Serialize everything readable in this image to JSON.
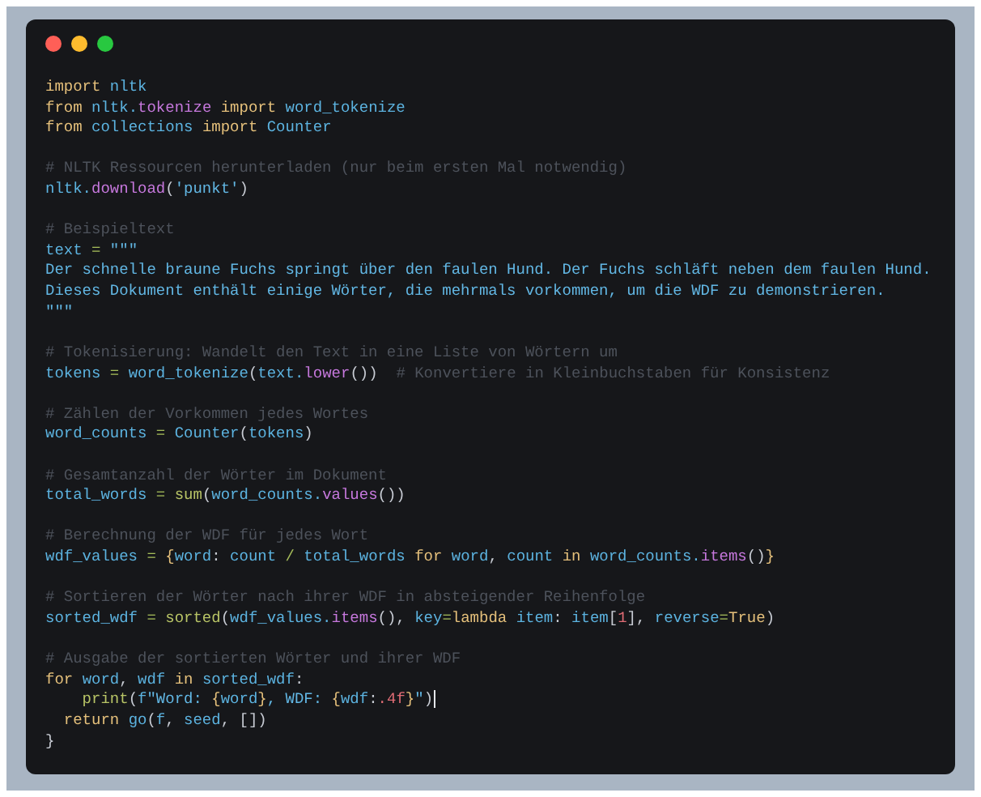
{
  "window": {
    "controls": [
      {
        "kind": "close"
      },
      {
        "kind": "minimize"
      },
      {
        "kind": "maximize"
      }
    ]
  },
  "lines": [
    {
      "kind": "code",
      "tokens": [
        {
          "kind": "kw",
          "text": "import "
        },
        {
          "kind": "name",
          "text": "nltk"
        }
      ]
    },
    {
      "kind": "code",
      "tokens": [
        {
          "kind": "kw",
          "text": "from "
        },
        {
          "kind": "name",
          "text": "nltk."
        },
        {
          "kind": "attr",
          "text": "tokenize "
        },
        {
          "kind": "kw",
          "text": "import "
        },
        {
          "kind": "name",
          "text": "word_tokenize"
        }
      ]
    },
    {
      "kind": "code",
      "tokens": [
        {
          "kind": "kw",
          "text": "from "
        },
        {
          "kind": "name",
          "text": "collections "
        },
        {
          "kind": "kw",
          "text": "import "
        },
        {
          "kind": "name",
          "text": "Counter"
        }
      ]
    },
    {
      "kind": "blank"
    },
    {
      "kind": "code",
      "tokens": [
        {
          "kind": "comment",
          "text": "# NLTK Ressourcen herunterladen (nur beim ersten Mal notwendig)"
        }
      ]
    },
    {
      "kind": "code",
      "tokens": [
        {
          "kind": "name",
          "text": "nltk."
        },
        {
          "kind": "attr",
          "text": "download"
        },
        {
          "kind": "punct",
          "text": "("
        },
        {
          "kind": "str",
          "text": "'punkt'"
        },
        {
          "kind": "punct",
          "text": ")"
        }
      ]
    },
    {
      "kind": "blank"
    },
    {
      "kind": "code",
      "tokens": [
        {
          "kind": "comment",
          "text": "# Beispieltext"
        }
      ]
    },
    {
      "kind": "code",
      "tokens": [
        {
          "kind": "name",
          "text": "text "
        },
        {
          "kind": "op",
          "text": "= "
        },
        {
          "kind": "str",
          "text": "\"\"\""
        }
      ]
    },
    {
      "kind": "code",
      "tokens": [
        {
          "kind": "str",
          "text": "Der schnelle braune Fuchs springt über den faulen Hund. Der Fuchs schläft neben dem faulen Hund."
        }
      ]
    },
    {
      "kind": "code",
      "tokens": [
        {
          "kind": "str",
          "text": "Dieses Dokument enthält einige Wörter, die mehrmals vorkommen, um die WDF zu demonstrieren."
        }
      ]
    },
    {
      "kind": "code",
      "tokens": [
        {
          "kind": "str",
          "text": "\"\"\""
        }
      ]
    },
    {
      "kind": "blank"
    },
    {
      "kind": "code",
      "tokens": [
        {
          "kind": "comment",
          "text": "# Tokenisierung: Wandelt den Text in eine Liste von Wörtern um"
        }
      ]
    },
    {
      "kind": "code",
      "tokens": [
        {
          "kind": "name",
          "text": "tokens "
        },
        {
          "kind": "op",
          "text": "= "
        },
        {
          "kind": "name",
          "text": "word_tokenize"
        },
        {
          "kind": "punct",
          "text": "("
        },
        {
          "kind": "name",
          "text": "text."
        },
        {
          "kind": "attr",
          "text": "lower"
        },
        {
          "kind": "punct",
          "text": "())  "
        },
        {
          "kind": "comment",
          "text": "# Konvertiere in Kleinbuchstaben für Konsistenz"
        }
      ]
    },
    {
      "kind": "blank"
    },
    {
      "kind": "code",
      "tokens": [
        {
          "kind": "comment",
          "text": "# Zählen der Vorkommen jedes Wortes"
        }
      ]
    },
    {
      "kind": "code",
      "tokens": [
        {
          "kind": "name",
          "text": "word_counts "
        },
        {
          "kind": "op",
          "text": "= "
        },
        {
          "kind": "name",
          "text": "Counter"
        },
        {
          "kind": "punct",
          "text": "("
        },
        {
          "kind": "name",
          "text": "tokens"
        },
        {
          "kind": "punct",
          "text": ")"
        }
      ]
    },
    {
      "kind": "blank"
    },
    {
      "kind": "code",
      "tokens": [
        {
          "kind": "comment",
          "text": "# Gesamtanzahl der Wörter im Dokument"
        }
      ]
    },
    {
      "kind": "code",
      "tokens": [
        {
          "kind": "name",
          "text": "total_words "
        },
        {
          "kind": "op",
          "text": "= "
        },
        {
          "kind": "builtin",
          "text": "sum"
        },
        {
          "kind": "punct",
          "text": "("
        },
        {
          "kind": "name",
          "text": "word_counts."
        },
        {
          "kind": "attr",
          "text": "values"
        },
        {
          "kind": "punct",
          "text": "())"
        }
      ]
    },
    {
      "kind": "blank"
    },
    {
      "kind": "code",
      "tokens": [
        {
          "kind": "comment",
          "text": "# Berechnung der WDF für jedes Wort"
        }
      ]
    },
    {
      "kind": "code",
      "tokens": [
        {
          "kind": "name",
          "text": "wdf_values "
        },
        {
          "kind": "op",
          "text": "= "
        },
        {
          "kind": "kw",
          "text": "{"
        },
        {
          "kind": "name",
          "text": "word"
        },
        {
          "kind": "punct",
          "text": ": "
        },
        {
          "kind": "name",
          "text": "count "
        },
        {
          "kind": "op",
          "text": "/ "
        },
        {
          "kind": "name",
          "text": "total_words "
        },
        {
          "kind": "kw",
          "text": "for "
        },
        {
          "kind": "name",
          "text": "word"
        },
        {
          "kind": "punct",
          "text": ", "
        },
        {
          "kind": "name",
          "text": "count "
        },
        {
          "kind": "kw",
          "text": "in "
        },
        {
          "kind": "name",
          "text": "word_counts."
        },
        {
          "kind": "attr",
          "text": "items"
        },
        {
          "kind": "punct",
          "text": "()"
        },
        {
          "kind": "kw",
          "text": "}"
        }
      ]
    },
    {
      "kind": "blank"
    },
    {
      "kind": "code",
      "tokens": [
        {
          "kind": "comment",
          "text": "# Sortieren der Wörter nach ihrer WDF in absteigender Reihenfolge"
        }
      ]
    },
    {
      "kind": "code",
      "tokens": [
        {
          "kind": "name",
          "text": "sorted_wdf "
        },
        {
          "kind": "op",
          "text": "= "
        },
        {
          "kind": "builtin",
          "text": "sorted"
        },
        {
          "kind": "punct",
          "text": "("
        },
        {
          "kind": "name",
          "text": "wdf_values."
        },
        {
          "kind": "attr",
          "text": "items"
        },
        {
          "kind": "punct",
          "text": "(), "
        },
        {
          "kind": "name",
          "text": "key"
        },
        {
          "kind": "op",
          "text": "="
        },
        {
          "kind": "kw",
          "text": "lambda "
        },
        {
          "kind": "name",
          "text": "item"
        },
        {
          "kind": "punct",
          "text": ": "
        },
        {
          "kind": "name",
          "text": "item"
        },
        {
          "kind": "punct",
          "text": "["
        },
        {
          "kind": "num",
          "text": "1"
        },
        {
          "kind": "punct",
          "text": "], "
        },
        {
          "kind": "name",
          "text": "reverse"
        },
        {
          "kind": "op",
          "text": "="
        },
        {
          "kind": "kw",
          "text": "True"
        },
        {
          "kind": "punct",
          "text": ")"
        }
      ]
    },
    {
      "kind": "blank"
    },
    {
      "kind": "code",
      "tokens": [
        {
          "kind": "comment",
          "text": "# Ausgabe der sortierten Wörter und ihrer WDF"
        }
      ]
    },
    {
      "kind": "code",
      "tokens": [
        {
          "kind": "kw",
          "text": "for "
        },
        {
          "kind": "name",
          "text": "word"
        },
        {
          "kind": "punct",
          "text": ", "
        },
        {
          "kind": "name",
          "text": "wdf "
        },
        {
          "kind": "kw",
          "text": "in "
        },
        {
          "kind": "name",
          "text": "sorted_wdf"
        },
        {
          "kind": "punct",
          "text": ":"
        }
      ]
    },
    {
      "kind": "code",
      "tokens": [
        {
          "kind": "builtin",
          "text": "    print"
        },
        {
          "kind": "punct",
          "text": "("
        },
        {
          "kind": "name",
          "text": "f"
        },
        {
          "kind": "str",
          "text": "\"Word: "
        },
        {
          "kind": "kw",
          "text": "{"
        },
        {
          "kind": "name",
          "text": "word"
        },
        {
          "kind": "kw",
          "text": "}"
        },
        {
          "kind": "str",
          "text": ", WDF: "
        },
        {
          "kind": "kw",
          "text": "{"
        },
        {
          "kind": "name",
          "text": "wdf"
        },
        {
          "kind": "punct",
          "text": ":"
        },
        {
          "kind": "num",
          "text": ".4f"
        },
        {
          "kind": "kw",
          "text": "}"
        },
        {
          "kind": "str",
          "text": "\""
        },
        {
          "kind": "punct",
          "text": ")"
        },
        {
          "kind": "cursor"
        }
      ]
    },
    {
      "kind": "code",
      "tokens": [
        {
          "kind": "kw",
          "text": "  return "
        },
        {
          "kind": "name",
          "text": "go"
        },
        {
          "kind": "punct",
          "text": "("
        },
        {
          "kind": "name",
          "text": "f"
        },
        {
          "kind": "punct",
          "text": ", "
        },
        {
          "kind": "name",
          "text": "seed"
        },
        {
          "kind": "punct",
          "text": ", [])"
        }
      ]
    },
    {
      "kind": "code",
      "tokens": [
        {
          "kind": "punct",
          "text": "}"
        }
      ]
    }
  ]
}
